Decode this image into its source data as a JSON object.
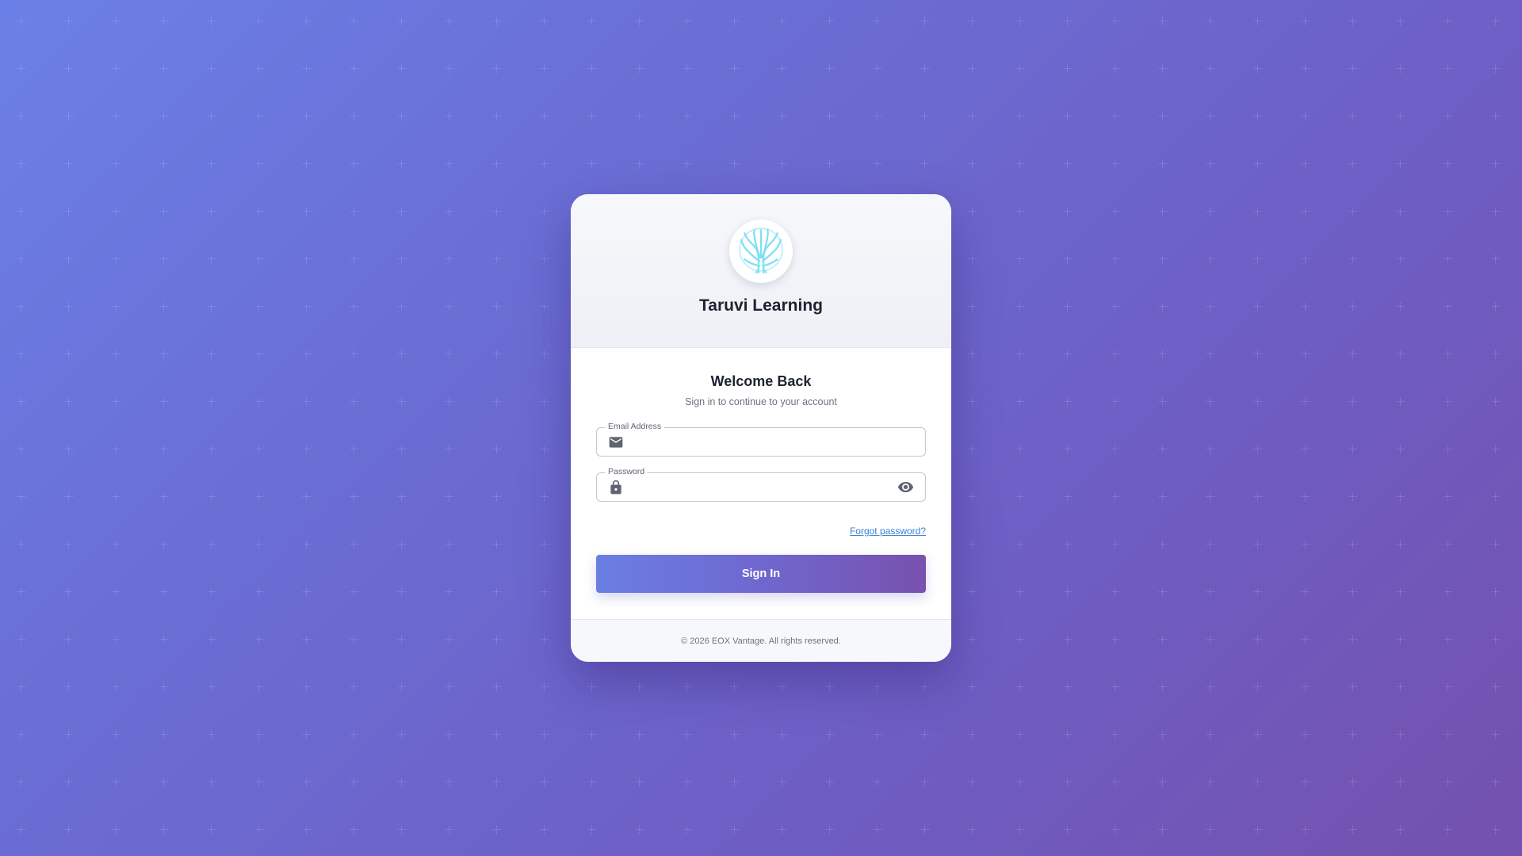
{
  "brand": {
    "name": "Taruvi Learning",
    "logo_icon": "tree-icon"
  },
  "login": {
    "heading": "Welcome Back",
    "subheading": "Sign in to continue to your account",
    "email": {
      "label": "Email Address",
      "value": "",
      "icon": "mail-icon"
    },
    "password": {
      "label": "Password",
      "value": "",
      "icon": "lock-icon",
      "toggle_icon": "eye-icon"
    },
    "forgot_link": "Forgot password?",
    "submit_label": "Sign In"
  },
  "footer": {
    "copyright": "© 2026 EOX Vantage. All rights reserved."
  },
  "colors": {
    "background_start": "#6b80e6",
    "background_end": "#7451ae",
    "link": "#3b82d6",
    "logo_tree": "#7fe0f2"
  }
}
